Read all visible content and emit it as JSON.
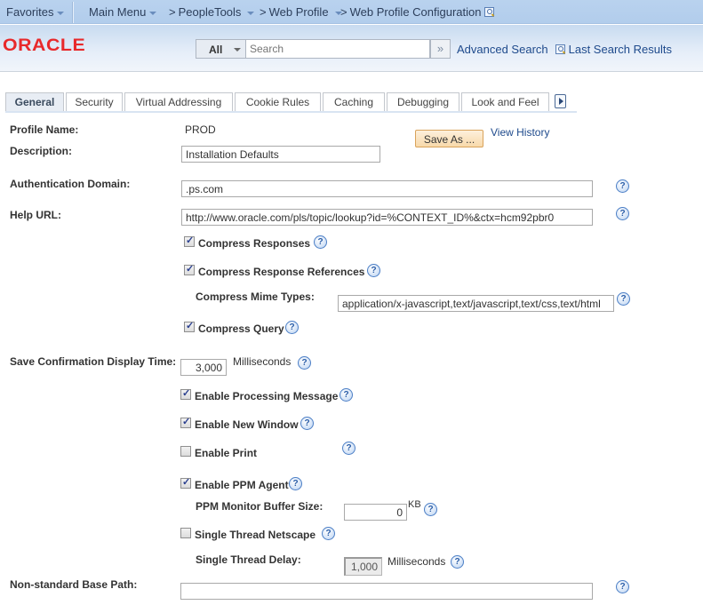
{
  "navbar": {
    "favorites": "Favorites",
    "main_menu": "Main Menu",
    "breadcrumbs": [
      "PeopleTools",
      "Web Profile",
      "Web Profile Configuration"
    ],
    "breadcrumb_sep": ">"
  },
  "header": {
    "logo": "ORACLE",
    "search_scope": "All",
    "search_placeholder": "Search",
    "search_go": "»",
    "advanced_search": "Advanced Search",
    "last_search_results": "Last Search Results"
  },
  "tabs": [
    {
      "label": "General",
      "active": true
    },
    {
      "label": "Security",
      "active": false
    },
    {
      "label": "Virtual Addressing",
      "active": false
    },
    {
      "label": "Cookie Rules",
      "active": false
    },
    {
      "label": "Caching",
      "active": false
    },
    {
      "label": "Debugging",
      "active": false
    },
    {
      "label": "Look and Feel",
      "active": false
    }
  ],
  "form": {
    "profile_name_label": "Profile Name:",
    "profile_name_value": "PROD",
    "save_as": "Save As ...",
    "view_history": "View History",
    "description_label": "Description:",
    "description_value": "Installation Defaults",
    "auth_domain_label": "Authentication Domain:",
    "auth_domain_value": ".ps.com",
    "help_url_label": "Help URL:",
    "help_url_value": "http://www.oracle.com/pls/topic/lookup?id=%CONTEXT_ID%&ctx=hcm92pbr0",
    "compress_responses": {
      "label": "Compress Responses",
      "checked": true
    },
    "compress_response_refs": {
      "label": "Compress Response References",
      "checked": true
    },
    "compress_mime_label": "Compress Mime Types:",
    "compress_mime_value": "application/x-javascript,text/javascript,text/css,text/html",
    "compress_query": {
      "label": "Compress Query",
      "checked": true
    },
    "save_confirm_label": "Save Confirmation Display Time:",
    "save_confirm_value": "3,000",
    "milliseconds": "Milliseconds",
    "enable_processing_message": {
      "label": "Enable Processing Message",
      "checked": true
    },
    "enable_new_window": {
      "label": "Enable New Window",
      "checked": true
    },
    "enable_print": {
      "label": "Enable Print",
      "checked": false
    },
    "enable_ppm_agent": {
      "label": "Enable PPM Agent",
      "checked": true
    },
    "ppm_buffer_label": "PPM Monitor Buffer Size:",
    "ppm_buffer_value": "0",
    "kb": "KB",
    "single_thread_netscape": {
      "label": "Single Thread Netscape",
      "checked": false
    },
    "single_thread_delay_label": "Single Thread Delay:",
    "single_thread_delay_value": "1,000",
    "non_standard_base_path_label": "Non-standard Base Path:",
    "non_standard_base_path_value": "",
    "help_glyph": "?"
  }
}
